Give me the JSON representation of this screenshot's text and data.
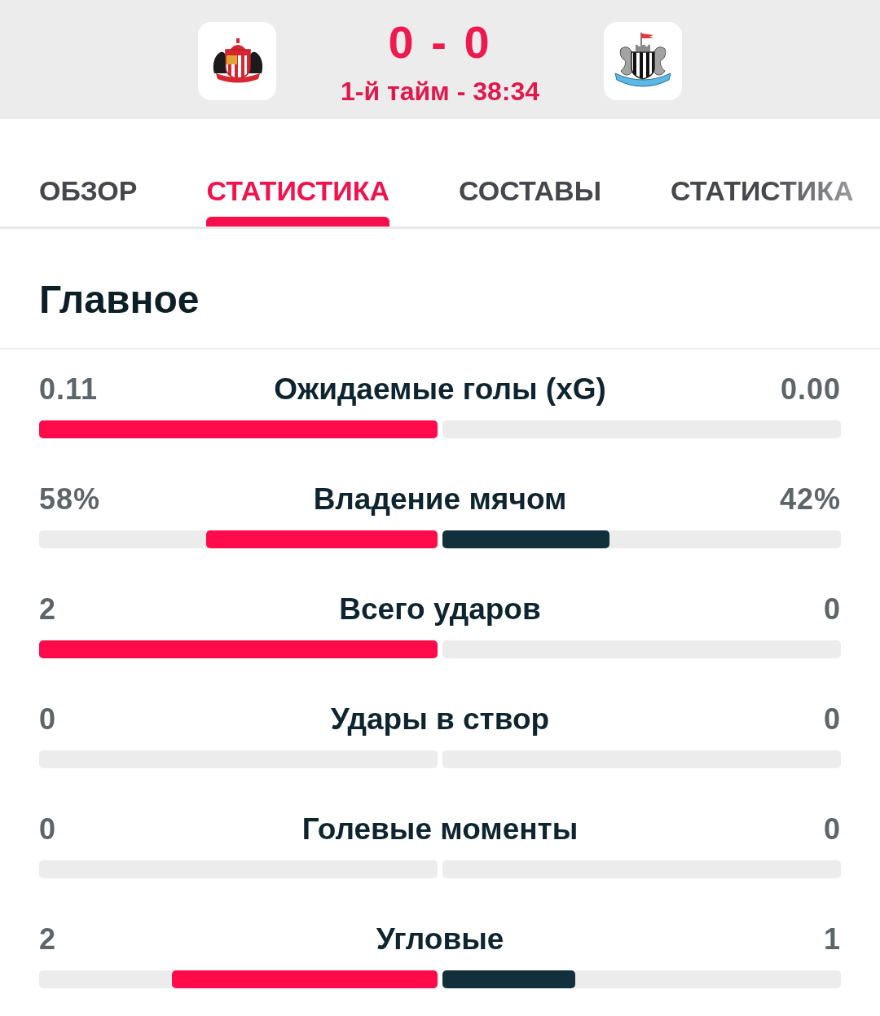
{
  "scoreboard": {
    "score": "0 - 0",
    "period": "1-й тайм - 38:34"
  },
  "tabs": [
    {
      "label": "ОБЗОР",
      "selected": false
    },
    {
      "label": "СТАТИСТИКА",
      "selected": true
    },
    {
      "label": "СОСТАВЫ",
      "selected": false
    },
    {
      "label": "СТАТИСТИКА",
      "selected": false
    }
  ],
  "section": {
    "title": "Главное"
  },
  "stats": [
    {
      "label": "Ожидаемые голы (xG)",
      "home": {
        "value": "0.11",
        "level": 1
      },
      "away": {
        "value": "0.00",
        "level": 0
      }
    },
    {
      "label": "Владение мячом",
      "home": {
        "value": "58%",
        "level": 0.58
      },
      "away": {
        "value": "42%",
        "level": 0.42
      }
    },
    {
      "label": "Всего ударов",
      "home": {
        "value": "2",
        "level": 1
      },
      "away": {
        "value": "0",
        "level": 0
      }
    },
    {
      "label": "Удары в створ",
      "home": {
        "value": "0",
        "level": 0
      },
      "away": {
        "value": "0",
        "level": 0
      }
    },
    {
      "label": "Голевые моменты",
      "home": {
        "value": "0",
        "level": 0
      },
      "away": {
        "value": "0",
        "level": 0
      }
    },
    {
      "label": "Угловые",
      "home": {
        "value": "2",
        "level": 0.667
      },
      "away": {
        "value": "1",
        "level": 0.333
      }
    }
  ]
}
